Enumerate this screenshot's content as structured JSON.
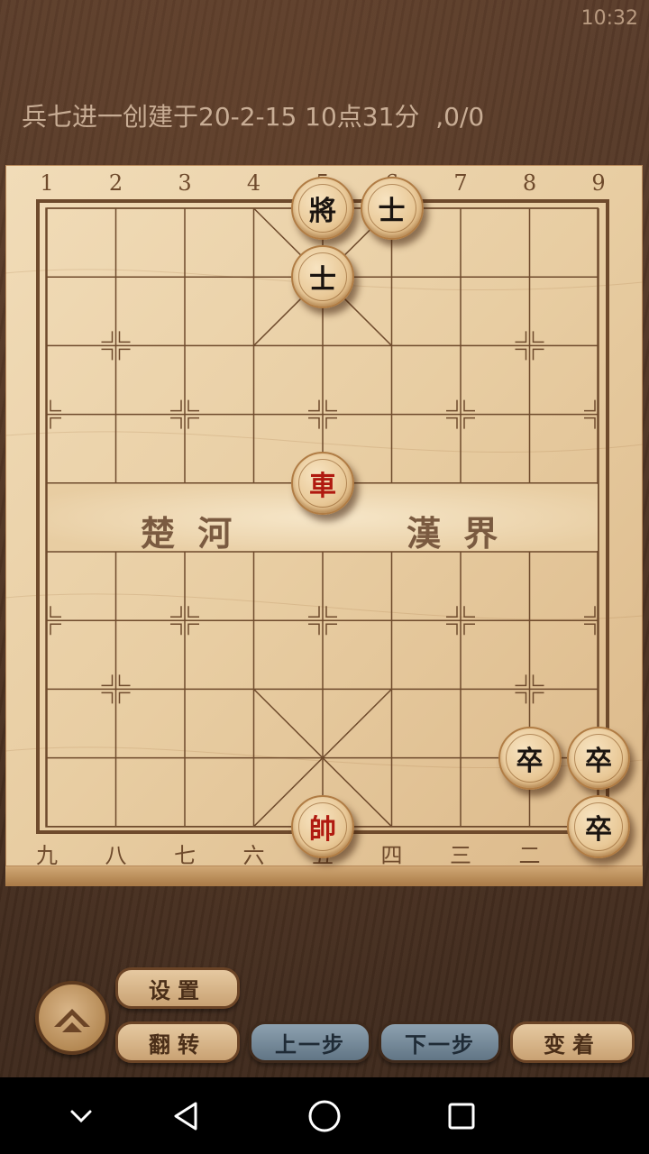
{
  "status": {
    "time": "10:32"
  },
  "game": {
    "record_title": "兵七进一创建于20-2-15 10点31分  ,0/0"
  },
  "board": {
    "top_labels": [
      "1",
      "2",
      "3",
      "4",
      "5",
      "6",
      "7",
      "8",
      "9"
    ],
    "bottom_labels": [
      "九",
      "八",
      "七",
      "六",
      "五",
      "四",
      "三",
      "二",
      "一"
    ],
    "river_left": "楚 河",
    "river_right": "漢 界",
    "pieces": [
      {
        "char": "將",
        "side": "black",
        "col": 4,
        "row": 0
      },
      {
        "char": "士",
        "side": "black",
        "col": 5,
        "row": 0
      },
      {
        "char": "士",
        "side": "black",
        "col": 4,
        "row": 1
      },
      {
        "char": "車",
        "side": "red",
        "col": 4,
        "row": 4
      },
      {
        "char": "卒",
        "side": "black",
        "col": 7,
        "row": 8
      },
      {
        "char": "卒",
        "side": "black",
        "col": 8,
        "row": 8
      },
      {
        "char": "帥",
        "side": "red",
        "col": 4,
        "row": 9
      },
      {
        "char": "卒",
        "side": "black",
        "col": 8,
        "row": 9
      }
    ]
  },
  "controls": {
    "settings": "设置",
    "flip": "翻转",
    "prev": "上一步",
    "next": "下一步",
    "variation": "变着"
  },
  "colors": {
    "board_wood": "#e8cda2",
    "line": "#6e4a2c",
    "red_piece_text": "#b01a10",
    "black_piece_text": "#1a1410"
  },
  "icons": {
    "up": "chevron-up-icon",
    "back": "nav-back-icon",
    "home": "nav-home-icon",
    "recents": "nav-recents-icon",
    "down": "nav-down-icon"
  }
}
